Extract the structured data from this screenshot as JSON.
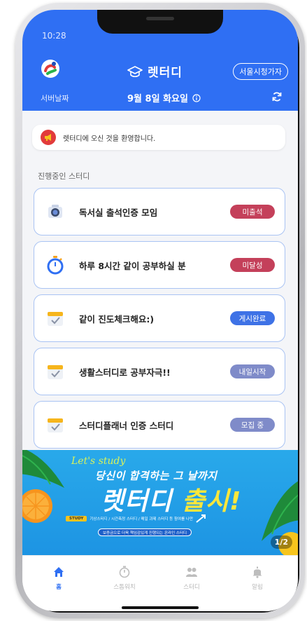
{
  "status_bar": {
    "time": "10:28"
  },
  "header": {
    "app_title": "렛터디",
    "user_button": "서울시청가자",
    "location": "서버날짜",
    "date": "9월 8일 화요일"
  },
  "welcome": {
    "text": "렛터디에 오신 것을 환영합니다."
  },
  "section": {
    "label": "진행중인 스터디"
  },
  "studies": [
    {
      "title": "독서실 출석인증 모임",
      "status": "미출석",
      "status_color": "#c4405a",
      "icon": "camera-icon"
    },
    {
      "title": "하루 8시간 같이 공부하실 분",
      "status": "미달성",
      "status_color": "#c4405a",
      "icon": "stopwatch-icon"
    },
    {
      "title": "같이 진도체크해요:)",
      "status": "게시완료",
      "status_color": "#3e72e6",
      "icon": "calendar-check-icon"
    },
    {
      "title": "생활스터디로 공부자극!!",
      "status": "내일시작",
      "status_color": "#7f8bc9",
      "icon": "calendar-check-icon"
    },
    {
      "title": "스터디플래너 인증 스터디",
      "status": "모집 중",
      "status_color": "#7f8bc9",
      "icon": "calendar-check-icon"
    }
  ],
  "banner": {
    "script": "Let's study",
    "line1": "당신이 합격하는 그 날까지",
    "line2_main": "렛터디 ",
    "line2_highlight": "출시!",
    "strip_tag": "STUDY",
    "strip_text": "기상스터디 / 시간측정 스터디 / 매일 과제 스터디 등 참여를 나만",
    "sub": "보증금으로 더욱 책임감있게 진행되는 온라인 스터디",
    "page_indicator": "1/2"
  },
  "tabs": [
    {
      "label": "홈",
      "icon": "home-icon",
      "active": true
    },
    {
      "label": "스톱워치",
      "icon": "stopwatch-icon",
      "active": false
    },
    {
      "label": "스터디",
      "icon": "people-icon",
      "active": false
    },
    {
      "label": "알림",
      "icon": "bell-icon",
      "active": false
    }
  ],
  "colors": {
    "brand": "#2f6ff3",
    "card_border": "#a9c3f3"
  }
}
